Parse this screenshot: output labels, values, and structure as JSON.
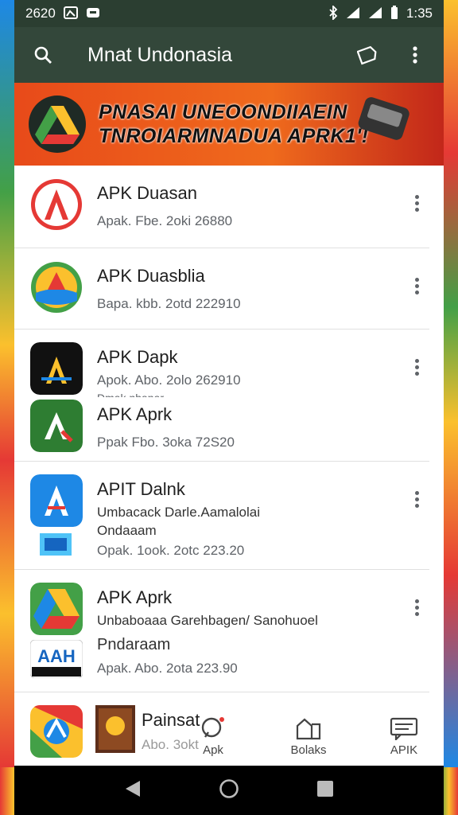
{
  "status_bar": {
    "time_left": "2620",
    "time_right": "1:35"
  },
  "app_bar": {
    "title": "Mnat Undonasia",
    "icons": [
      "search-icon",
      "tag-icon",
      "more-vert-icon"
    ]
  },
  "banner": {
    "line1": "PNASAI UNEOONDIIAEIN",
    "line2": "TNROIARMNADUA APRK1'!"
  },
  "list": {
    "items": [
      {
        "title": "APK Duasan",
        "subtitle": "Apak. Fbe. 2oki 26880"
      },
      {
        "title": "APK Duasblia",
        "subtitle": "Bapa. kbb. 2otd 222910"
      },
      {
        "title": "APK Dapk",
        "subtitle": "Apok. Abo. 2olo 262910",
        "subtitle2": "Dmak nhanar"
      },
      {
        "title": "APK Aprk",
        "subtitle": "Ppak Fbo. 3oka 72S20"
      },
      {
        "title": "APIT Dalnk",
        "subtitle": "Umbacack Darle.Aamalolai",
        "subtitle2": "Ondaaam",
        "subtitle3": "Opak. 1ook. 2otc 223.20"
      },
      {
        "title": "APK Aprk",
        "subtitle": "Unbaboaaa Garehbagen/ Sanohuoel",
        "subtitle2": "Pndaraam",
        "subtitle3": "Apak. Abo. 2ota 223.90"
      },
      {
        "title": "Painsat",
        "subtitle": "Abo. 3okt"
      }
    ]
  },
  "bottom_nav": {
    "items": [
      {
        "label": "Apk",
        "icon": "chat-icon"
      },
      {
        "label": "Bolaks",
        "icon": "building-icon"
      },
      {
        "label": "APIK",
        "icon": "message-icon"
      }
    ]
  },
  "colors": {
    "status_bar": "#2b3e31",
    "app_bar": "#33473a",
    "banner": "#ef6a1c"
  }
}
